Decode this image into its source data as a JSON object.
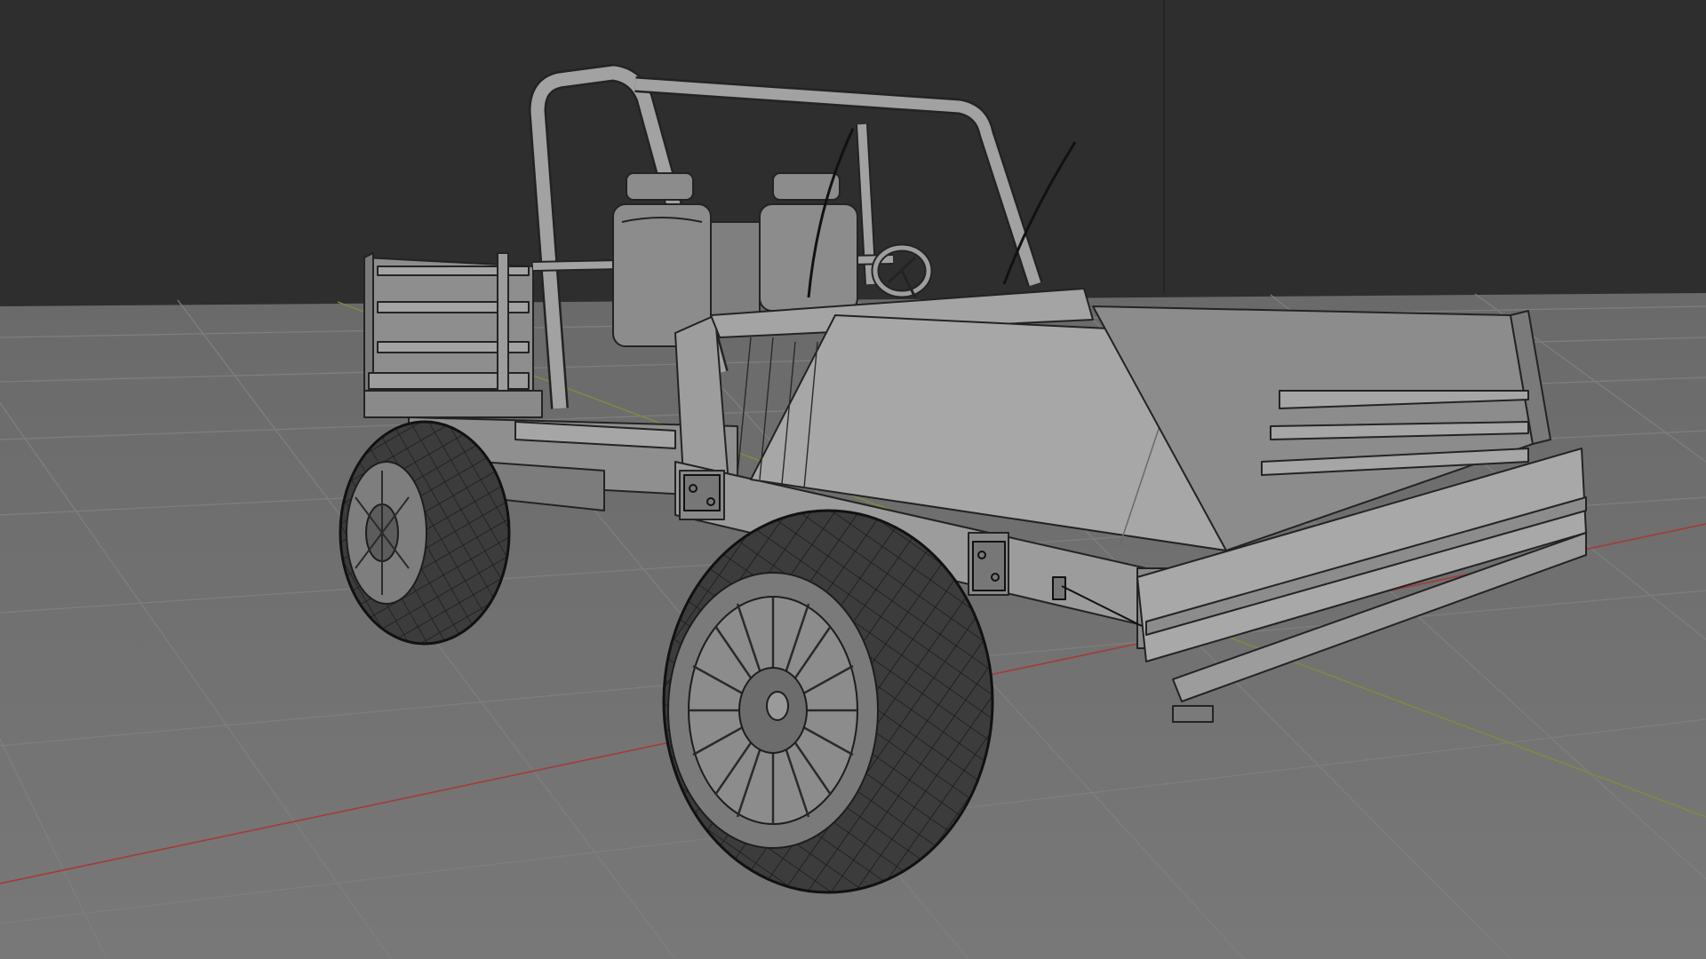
{
  "viewport": {
    "mode": "edit-wireframe-overlay",
    "background_color": "#2e2e2e",
    "ground_color": "#6f6f6f",
    "grid_line_color": "#808080",
    "x_axis_color": "#a33b3b",
    "y_axis_color": "#7b8f3a",
    "model_fill": "#9a9a9a",
    "model_edge": "#222222",
    "tire_color": "#3a3a3a"
  },
  "scene": {
    "object": "buggy-vehicle-model",
    "parts": [
      "roll-cage",
      "seats",
      "steering-wheel",
      "antenna-left",
      "antenna-right",
      "rear-cargo-rack",
      "front-cargo-bed",
      "hood-panel",
      "chassis",
      "wheels"
    ]
  }
}
